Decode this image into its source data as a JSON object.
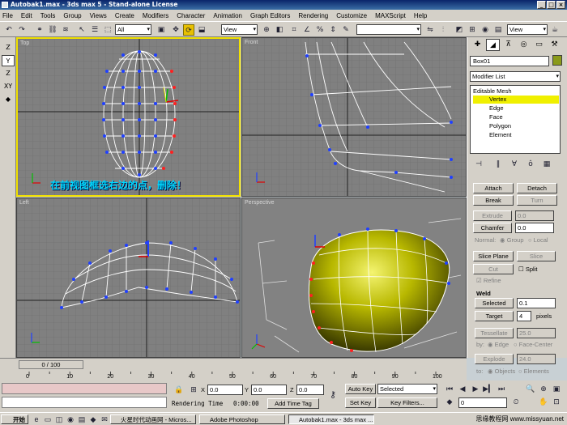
{
  "window": {
    "title": "Autobak1.max - 3ds max 5 - Stand-alone License"
  },
  "menu": [
    "File",
    "Edit",
    "Tools",
    "Group",
    "Views",
    "Create",
    "Modifiers",
    "Character",
    "Animation",
    "Graph Editors",
    "Rendering",
    "Customize",
    "MAXScript",
    "Help"
  ],
  "toolbar": {
    "selection_filter": "All",
    "ref_coord": "View",
    "named_selection": "",
    "render_view": "View"
  },
  "left_tools": [
    "Z",
    "Y",
    "Z",
    "XY",
    "◆"
  ],
  "viewports": {
    "top": "Top",
    "front": "Front",
    "left": "Left",
    "perspective": "Perspective"
  },
  "annotation": "在前视图框选右边的点，删除！",
  "command_panel": {
    "object_name": "Box01",
    "modifier_list": "Modifier List",
    "stack": [
      "Editable Mesh",
      "Vertex",
      "Edge",
      "Face",
      "Polygon",
      "Element"
    ],
    "attach": "Attach",
    "detach": "Detach",
    "break": "Break",
    "turn": "Turn",
    "extrude": "Extrude",
    "extrude_val": "0.0",
    "chamfer": "Chamfer",
    "chamfer_val": "0.0",
    "normal_label": "Normal:",
    "normal_group": "Group",
    "normal_local": "Local",
    "slice_plane": "Slice Plane",
    "slice": "Slice",
    "cut": "Cut",
    "split": "Split",
    "refine": "Refine",
    "weld_label": "Weld",
    "weld_selected": "Selected",
    "weld_selected_val": "0.1",
    "weld_target": "Target",
    "weld_target_val": "4",
    "pixels": "pixels",
    "tessellate": "Tessellate",
    "tessellate_val": "25.0",
    "by_label": "by:",
    "edge": "Edge",
    "face_center": "Face-Center",
    "explode": "Explode",
    "explode_val": "24.0",
    "to_label": "to:",
    "objects": "Objects",
    "elements": "Elements"
  },
  "timeline": {
    "frame": "0 / 100",
    "ticks": [
      "0",
      "10",
      "20",
      "30",
      "40",
      "50",
      "60",
      "70",
      "80",
      "90",
      "100"
    ]
  },
  "status": {
    "x_label": "X",
    "x_val": "0.0",
    "y_label": "Y",
    "y_val": "0.0",
    "z_label": "Z",
    "z_val": "0.0",
    "auto_key": "Auto Key",
    "selected": "Selected",
    "set_key": "Set Key",
    "key_filters": "Key Filters...",
    "rendering_time_label": "Rendering Time",
    "rendering_time": "0:00:00",
    "add_time_tag": "Add Time Tag",
    "frame_field": "0"
  },
  "taskbar": {
    "start": "开始",
    "tasks": [
      "火星时代动画网 - Micros...",
      "Adobe Photoshop",
      "Autobak1.max - 3ds max ..."
    ],
    "tray": "思缘教程网 www.missyuan.net"
  }
}
